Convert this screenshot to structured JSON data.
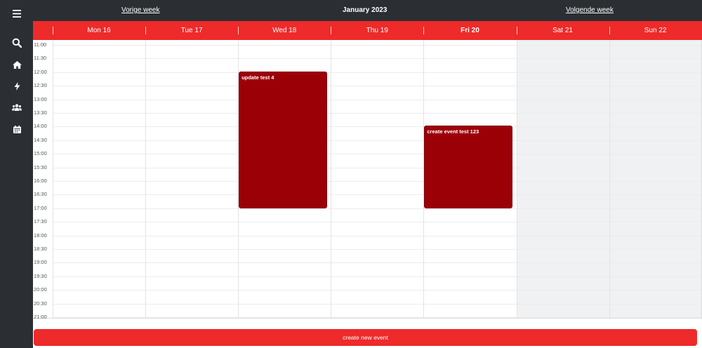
{
  "nav": {
    "prev_week": "Vorige week",
    "next_week": "Volgende week",
    "month_title": "January 2023"
  },
  "sidebar": {
    "icons": [
      "menu-icon",
      "search-icon",
      "home-icon",
      "bolt-icon",
      "users-icon",
      "calendar-icon"
    ]
  },
  "days": [
    {
      "label": "Mon 16",
      "weekend": false,
      "today": false
    },
    {
      "label": "Tue 17",
      "weekend": false,
      "today": false
    },
    {
      "label": "Wed 18",
      "weekend": false,
      "today": false
    },
    {
      "label": "Thu 19",
      "weekend": false,
      "today": false
    },
    {
      "label": "Fri 20",
      "weekend": false,
      "today": true
    },
    {
      "label": "Sat 21",
      "weekend": true,
      "today": false
    },
    {
      "label": "Sun 22",
      "weekend": true,
      "today": false
    }
  ],
  "times": [
    "11:00",
    "11:30",
    "12:00",
    "12:30",
    "13:00",
    "13:30",
    "14:00",
    "14:30",
    "15:00",
    "15:30",
    "16:00",
    "16:30",
    "17:00",
    "17:30",
    "18:00",
    "18:30",
    "19:00",
    "19:30",
    "20:00",
    "20:30",
    "21:00"
  ],
  "events": [
    {
      "title": "update test 4",
      "day": 2,
      "start": "12:00",
      "end": "17:00"
    },
    {
      "title": "create event test 123",
      "day": 4,
      "start": "14:00",
      "end": "17:00"
    }
  ],
  "colors": {
    "accent": "#ee2a2a",
    "dark": "#2b2f33",
    "event": "#9c0007",
    "weekend": "#f0f1f3"
  },
  "create_button": "create new event"
}
